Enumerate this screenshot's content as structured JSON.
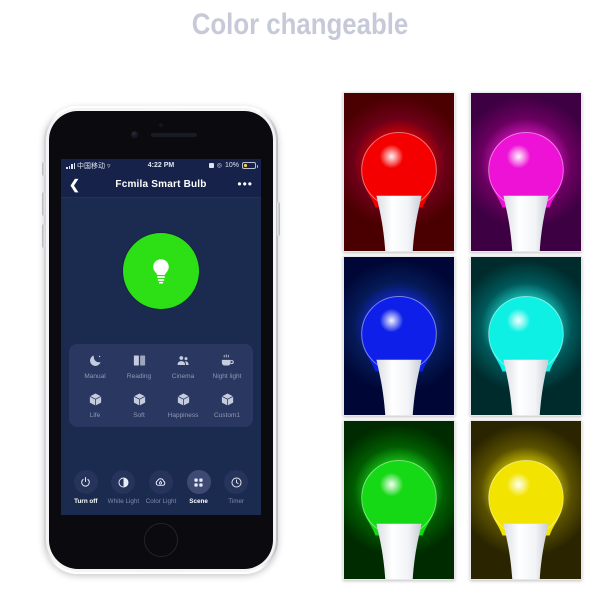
{
  "page": {
    "title": "Color changeable",
    "background": "#ffffff",
    "title_color": "#c6cad8"
  },
  "phone": {
    "statusbar": {
      "carrier": "中国移动",
      "wifi_icon": "wifi-icon",
      "time": "4:22 PM",
      "alarm_icon": "alarm-icon",
      "location_icon": "location-icon",
      "battery_percent": "10%",
      "battery_icon": "battery-low-icon"
    },
    "navbar": {
      "back_icon": "chevron-left-icon",
      "title": "Fcmila Smart Bulb",
      "more_icon": "more-horizontal-icon"
    },
    "power_toggle": {
      "icon": "bulb-icon",
      "state_color": "#2de015",
      "state": "on"
    },
    "scenes": [
      {
        "label": "Manual",
        "icon": "moon-icon"
      },
      {
        "label": "Reading",
        "icon": "book-icon"
      },
      {
        "label": "Cinema",
        "icon": "people-icon"
      },
      {
        "label": "Night light",
        "icon": "coffee-cup-icon"
      },
      {
        "label": "Life",
        "icon": "cube-icon"
      },
      {
        "label": "Soft",
        "icon": "cube-icon"
      },
      {
        "label": "Happiness",
        "icon": "cube-icon"
      },
      {
        "label": "Custom1",
        "icon": "cube-icon"
      }
    ],
    "toolbar": [
      {
        "label": "Turn off",
        "icon": "power-icon",
        "active": true
      },
      {
        "label": "White Light",
        "icon": "contrast-icon",
        "active": false
      },
      {
        "label": "Color Light",
        "icon": "palette-icon",
        "active": false
      },
      {
        "label": "Scene",
        "icon": "grid-icon",
        "active": true
      },
      {
        "label": "Timer",
        "icon": "clock-icon",
        "active": false
      }
    ]
  },
  "bulb_gallery": [
    {
      "name": "red-bulb",
      "color": "#f40000",
      "glow": "#ff0000",
      "edge": "#4a0000",
      "corner": "#6d0018"
    },
    {
      "name": "magenta-bulb",
      "color": "#ee12d6",
      "glow": "#ff1ae0",
      "edge": "#3d0042",
      "corner": "#6a0060"
    },
    {
      "name": "blue-bulb",
      "color": "#0d1fe8",
      "glow": "#1830ff",
      "edge": "#000736",
      "corner": "#051a58"
    },
    {
      "name": "cyan-bulb",
      "color": "#0ff0e4",
      "glow": "#25ffee",
      "edge": "#002b2c",
      "corner": "#00585a"
    },
    {
      "name": "green-bulb",
      "color": "#15d915",
      "glow": "#22ff22",
      "edge": "#002a00",
      "corner": "#015c01"
    },
    {
      "name": "yellow-bulb",
      "color": "#f2e400",
      "glow": "#fff600",
      "edge": "#2a2500",
      "corner": "#5a5000"
    }
  ]
}
